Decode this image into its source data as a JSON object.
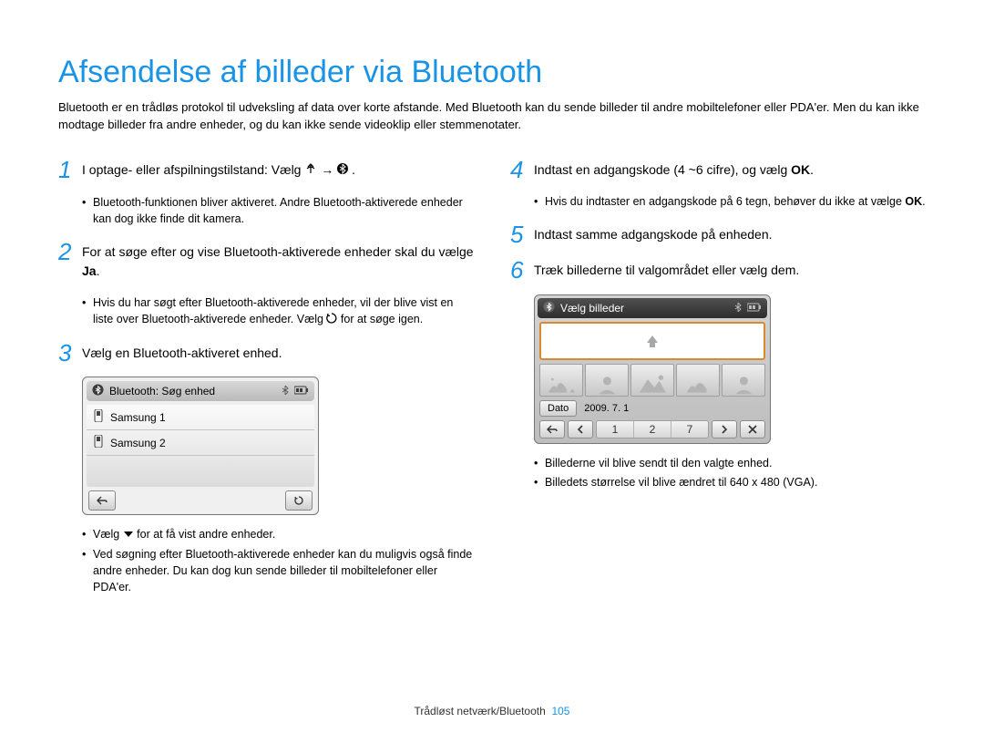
{
  "title": "Afsendelse af billeder via Bluetooth",
  "intro": "Bluetooth er en trådløs protokol til udveksling af data over korte afstande. Med Bluetooth kan du sende billeder til andre mobiltelefoner eller PDA'er. Men du kan ikke modtage billeder fra andre enheder, og du kan ikke sende videoklip eller stemmenotater.",
  "steps": {
    "s1": {
      "text_a": "I optage- eller afspilningstilstand: Vælg ",
      "text_b": " → ",
      "text_c": ".",
      "bullets": [
        "Bluetooth-funktionen bliver aktiveret. Andre Bluetooth-aktiverede enheder kan dog ikke finde dit kamera."
      ]
    },
    "s2": {
      "text_a": "For at søge efter og vise Bluetooth-aktiverede enheder skal du vælge ",
      "text_b": "Ja",
      "text_c": ".",
      "bullets_a": "Hvis du har søgt efter Bluetooth-aktiverede enheder, vil der blive vist en liste over Bluetooth-aktiverede enheder. Vælg ",
      "bullets_b": " for at søge igen."
    },
    "s3": {
      "text": "Vælg en Bluetooth-aktiveret enhed.",
      "bullets_a": "Vælg ",
      "bullets_b": " for at få vist andre enheder.",
      "bullets_c": "Ved søgning efter Bluetooth-aktiverede enheder kan du muligvis også finde andre enheder. Du kan dog kun sende billeder til mobiltelefoner eller PDA'er."
    },
    "s4": {
      "text_a": "Indtast en adgangskode (4 ~6 cifre), og vælg ",
      "text_b": "OK",
      "text_c": ".",
      "bullets_a": "Hvis du indtaster en adgangskode på 6 tegn, behøver du ikke at vælge ",
      "bullets_b": "OK",
      "bullets_c": "."
    },
    "s5": {
      "text": "Indtast samme adgangskode på enheden."
    },
    "s6": {
      "text": "Træk billederne til valgområdet eller vælg dem.",
      "bullets": [
        "Billederne vil blive sendt til den valgte enhed.",
        "Billedets størrelse vil blive ændret til 640 x 480 (VGA)."
      ]
    }
  },
  "cam1": {
    "title": "Bluetooth: Søg enhed",
    "items": [
      "Samsung 1",
      "Samsung 2"
    ]
  },
  "cam2": {
    "title": "Vælg billeder",
    "date_button": "Dato",
    "date_label": "2009. 7. 1",
    "pages": [
      "1",
      "2",
      "7"
    ]
  },
  "footer": {
    "text": "Trådløst netværk/Bluetooth",
    "page": "105"
  }
}
